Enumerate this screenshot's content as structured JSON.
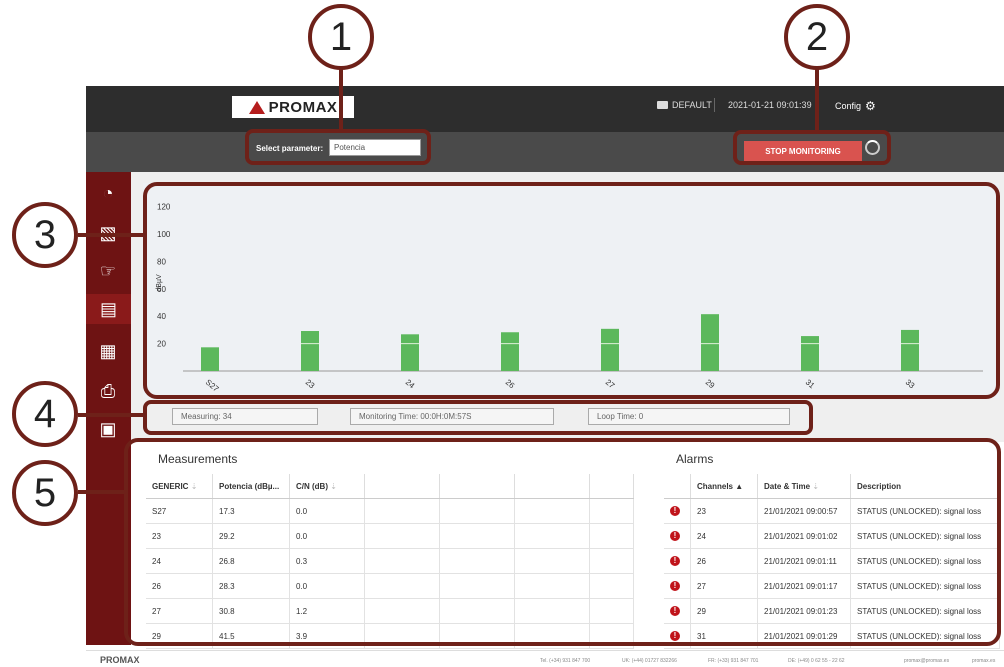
{
  "header": {
    "logo_text": "PROMAX",
    "folder_label": "DEFAULT",
    "datetime": "2021-01-21 09:01:39",
    "config_label": "Config"
  },
  "param": {
    "label": "Select parameter:",
    "value": "Potencia"
  },
  "stop_button": "STOP MONITORING",
  "callouts": [
    "1",
    "2",
    "3",
    "4",
    "5"
  ],
  "sidebar": {
    "icons": [
      "gauge-icon",
      "spectrum-icon",
      "hand-pointer-icon",
      "monitor-bars-icon",
      "calendar-schedule-icon",
      "printer-icon",
      "clipboard-clock-icon"
    ],
    "active_index": 3
  },
  "status": {
    "measuring": "Measuring: 34",
    "monitoring_time": "Monitoring Time: 00:0H:0M:57S",
    "loop_time": "Loop Time: 0"
  },
  "measurements": {
    "title": "Measurements",
    "columns": [
      "GENERIC",
      "Potencia (dBµ...",
      "C/N (dB)",
      "",
      "",
      "",
      ""
    ],
    "rows": [
      [
        "S27",
        "17.3",
        "0.0"
      ],
      [
        "23",
        "29.2",
        "0.0"
      ],
      [
        "24",
        "26.8",
        "0.3"
      ],
      [
        "26",
        "28.3",
        "0.0"
      ],
      [
        "27",
        "30.8",
        "1.2"
      ],
      [
        "29",
        "41.5",
        "3.9"
      ]
    ]
  },
  "alarms": {
    "title": "Alarms",
    "columns": [
      "",
      "Channels",
      "Date & Time",
      "Description"
    ],
    "rows": [
      [
        "23",
        "21/01/2021 09:00:57",
        "STATUS (UNLOCKED): signal loss"
      ],
      [
        "24",
        "21/01/2021 09:01:02",
        "STATUS (UNLOCKED): signal loss"
      ],
      [
        "26",
        "21/01/2021 09:01:11",
        "STATUS (UNLOCKED): signal loss"
      ],
      [
        "27",
        "21/01/2021 09:01:17",
        "STATUS (UNLOCKED): signal loss"
      ],
      [
        "29",
        "21/01/2021 09:01:23",
        "STATUS (UNLOCKED): signal loss"
      ],
      [
        "31",
        "21/01/2021 09:01:29",
        "STATUS (UNLOCKED): signal loss"
      ]
    ]
  },
  "chart_data": {
    "type": "bar",
    "categories": [
      "S27",
      "23",
      "24",
      "26",
      "27",
      "29",
      "31",
      "33"
    ],
    "values": [
      17.3,
      29.2,
      26.8,
      28.3,
      30.8,
      41.5,
      25.5,
      30.0
    ],
    "ylabel": "dBµV",
    "yticks": [
      20,
      40,
      60,
      80,
      100,
      120
    ],
    "ylim": [
      0,
      130
    ],
    "bar_color": "#5cb85c"
  },
  "footer": {
    "logo_text": "PROMAX",
    "contacts": [
      "Tel. (+34) 931 847 700",
      "UK: (+44) 01727 832266",
      "FR: (+33) 931 847 701",
      "DE: (+49) 0 62 55 - 22 62",
      "promax@promax.es",
      "promax.es"
    ]
  }
}
